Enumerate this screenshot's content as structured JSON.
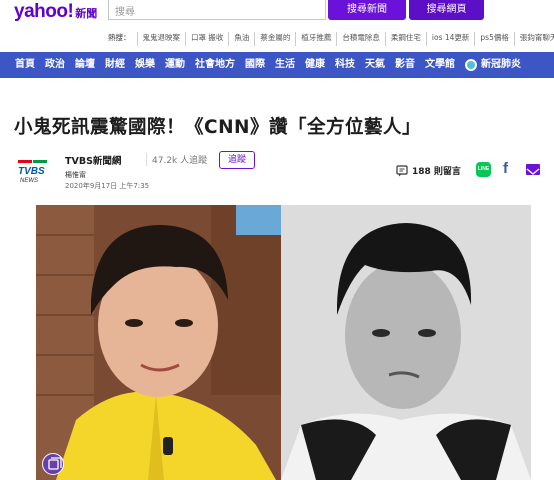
{
  "header": {
    "logo": "yahoo!",
    "logo_sub": "新聞",
    "search_placeholder": "搜尋",
    "search_news_label": "搜尋新聞",
    "search_web_label": "搜尋網頁"
  },
  "trending": {
    "label": "熱搜：",
    "items": [
      "鬼鬼退映案",
      "口罩 搬收",
      "魚油",
      "蔡金屬的",
      "植牙推薦",
      "台積電除息",
      "柔鋼住宅",
      "ios 14更新",
      "ps5價格",
      "張鈞甯聊天"
    ]
  },
  "nav": {
    "items": [
      "首頁",
      "政治",
      "論壇",
      "財經",
      "娛樂",
      "運動",
      "社會地方",
      "國際",
      "生活",
      "健康",
      "科技",
      "天氣",
      "影音",
      "文學館"
    ],
    "covid_label": "新冠肺炎"
  },
  "article": {
    "headline": "小鬼死訊震驚國際！《CNN》讚「全方位藝人」",
    "source_logo_text": "TVBS",
    "source_logo_sub": "NEWS",
    "source_name": "TVBS新聞網",
    "followers": "47.2k 人追蹤",
    "follow_label": "追蹤",
    "author": "楊惟甯",
    "date": "2020年9月17日 上午7:35",
    "comments": "188 則留言",
    "line_label": "LINE",
    "fb_label": "f"
  },
  "colors": {
    "brand": "#6001d2",
    "nav_bg": "#3c56c6",
    "line_green": "#06c755",
    "fb_blue": "#3b5998"
  }
}
